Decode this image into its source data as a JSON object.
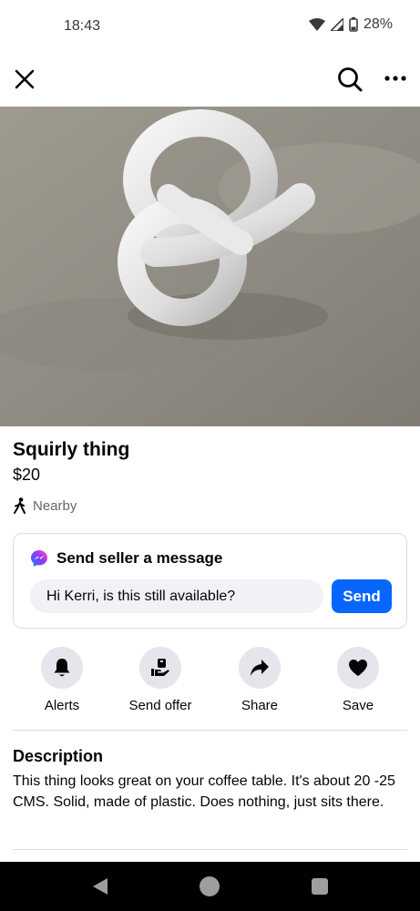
{
  "status_bar": {
    "time": "18:43",
    "battery": "28%",
    "icons": [
      "wifi-icon",
      "signal-icon",
      "battery-icon"
    ]
  },
  "top_bar": {
    "icons": [
      "close-icon",
      "search-icon",
      "more-icon"
    ]
  },
  "listing": {
    "title": "Squirly thing",
    "price": "$20",
    "location": "Nearby",
    "location_icon": "walking-person-icon"
  },
  "message": {
    "title": "Send seller a message",
    "input_value": "Hi Kerri, is this still available?",
    "send_label": "Send",
    "icon": "messenger-icon"
  },
  "actions": [
    {
      "label": "Alerts",
      "icon": "bell-icon"
    },
    {
      "label": "Send offer",
      "icon": "offer-hand-icon"
    },
    {
      "label": "Share",
      "icon": "share-arrow-icon"
    },
    {
      "label": "Save",
      "icon": "heart-icon"
    }
  ],
  "description": {
    "heading": "Description",
    "text": "This thing looks great on your coffee table. It's about 20 -25 CMS. Solid, made of plastic. Does nothing, just sits there."
  },
  "nav_bar": {
    "icons": [
      "back-icon",
      "home-icon",
      "recents-icon"
    ]
  },
  "colors": {
    "accent": "#0866ff",
    "text_secondary": "#65676b",
    "icon_circle": "#e4e6eb",
    "input_bg": "#f0f2f5"
  }
}
